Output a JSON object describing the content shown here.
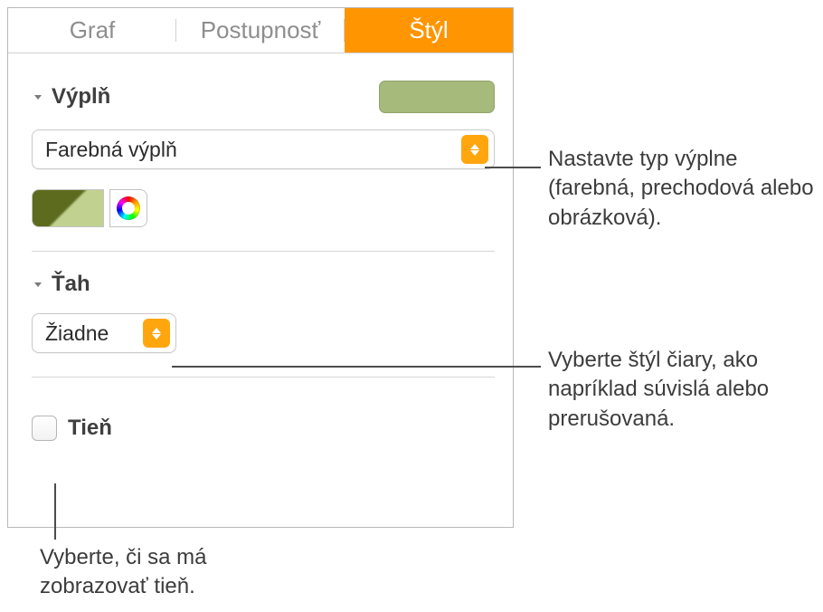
{
  "tabs": {
    "graph": "Graf",
    "series": "Postupnosť",
    "style": "Štýl"
  },
  "fill": {
    "title": "Výplň",
    "select": "Farebná výplň",
    "swatch_color": "#a5ba7b"
  },
  "stroke": {
    "title": "Ťah",
    "select": "Žiadne"
  },
  "shadow": {
    "label": "Tieň"
  },
  "callouts": {
    "fill_type": "Nastavte typ výplne (farebná, prechodová alebo obrázková).",
    "stroke_style": "Vyberte štýl čiary, ako napríklad súvislá alebo prerušovaná.",
    "shadow_cb": "Vyberte, či sa má zobrazovať tieň."
  }
}
